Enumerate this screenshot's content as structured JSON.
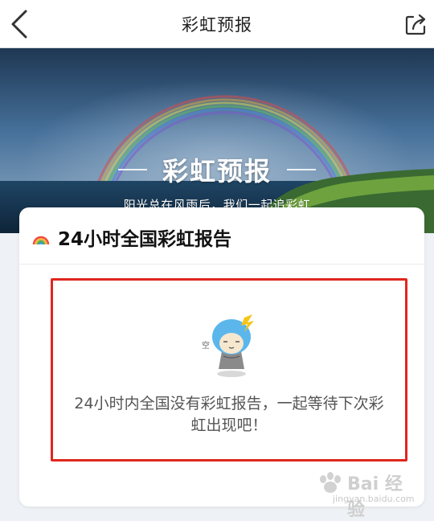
{
  "nav": {
    "title": "彩虹预报"
  },
  "banner": {
    "title": "彩虹预报",
    "subtitle": "阳光总在风雨后，我们一起追彩虹"
  },
  "card": {
    "title": "24小时全国彩虹报告",
    "empty_message": "24小时内全国没有彩虹报告，一起等待下次彩虹出现吧！",
    "mascot_caption": "空"
  },
  "watermark": {
    "brand": "Bai 经验",
    "url": "jingyan.baidu.com"
  },
  "colors": {
    "highlight_border": "#e0261f",
    "card_bg": "#ffffff",
    "page_bg": "#eef1f5",
    "text_primary": "#111111",
    "text_secondary": "#555555"
  },
  "icons": {
    "back": "chevron-left-icon",
    "share": "share-icon",
    "rainbow": "rainbow-icon"
  }
}
